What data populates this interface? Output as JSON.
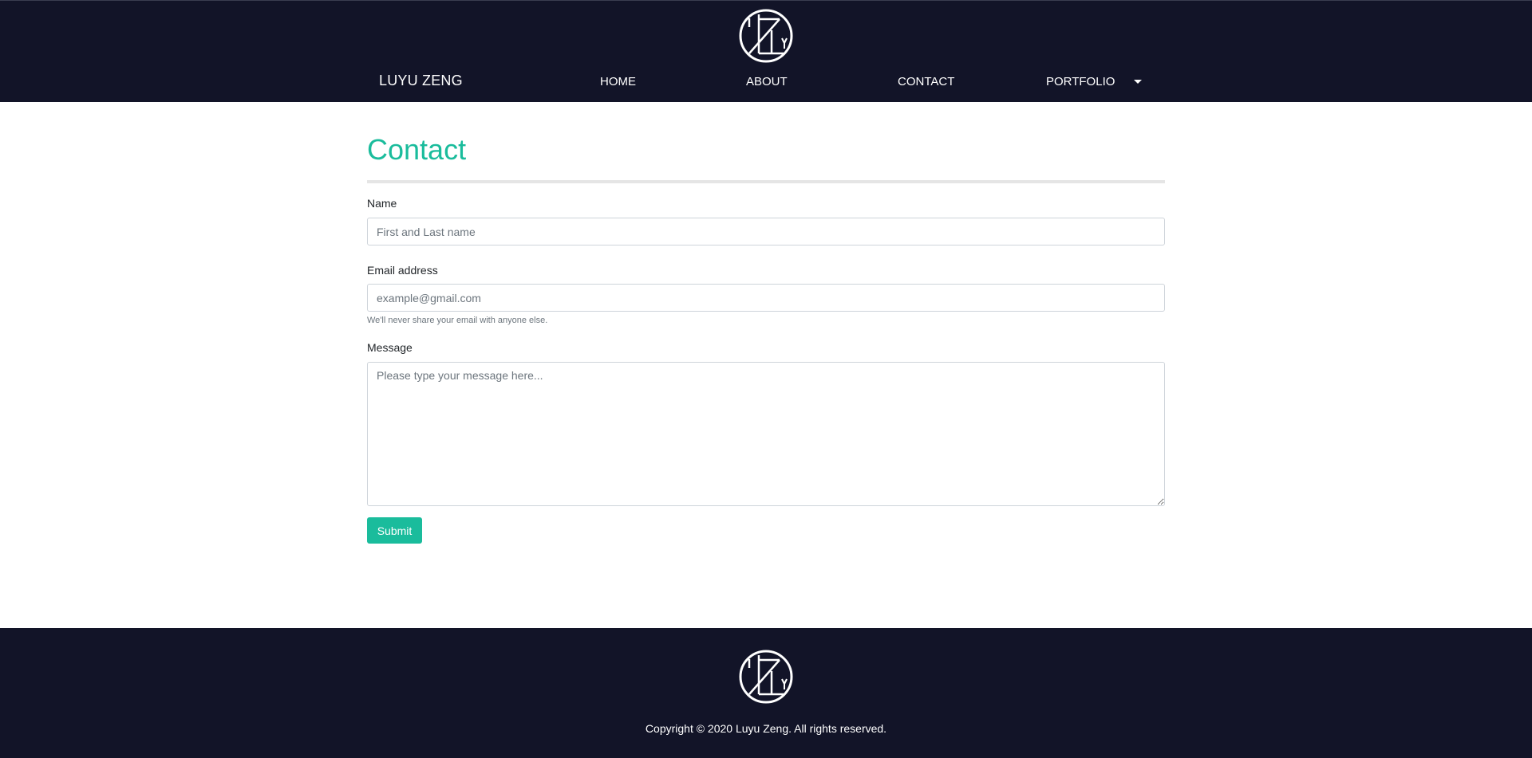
{
  "header": {
    "logo_icon": "lzy-monogram-icon",
    "brand": "LUYU ZENG",
    "nav": {
      "home": "HOME",
      "about": "ABOUT",
      "contact": "CONTACT",
      "portfolio": "PORTFOLIO"
    },
    "dropdown_icon": "caret-down-icon"
  },
  "main": {
    "title": "Contact",
    "form": {
      "name_label": "Name",
      "name_placeholder": "First and Last name",
      "name_value": "",
      "email_label": "Email address",
      "email_placeholder": "example@gmail.com",
      "email_value": "",
      "email_help": "We'll never share your email with anyone else.",
      "message_label": "Message",
      "message_placeholder": "Please type your message here...",
      "message_value": "",
      "submit_label": "Submit"
    }
  },
  "footer": {
    "logo_icon": "lzy-monogram-icon",
    "copyright": "Copyright © 2020 Luyu Zeng. All rights reserved."
  },
  "colors": {
    "header_bg": "#121428",
    "accent": "#1abc9c",
    "text_white": "#ffffff"
  }
}
